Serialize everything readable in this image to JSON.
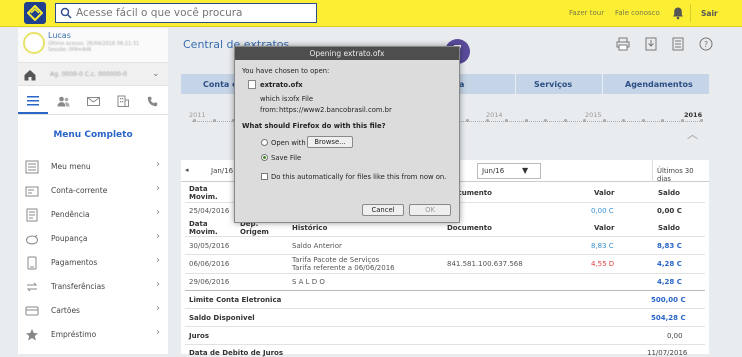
{
  "topbar": {
    "search_placeholder": "Acesse fácil o que você procura",
    "link_tour": "Fazer tour",
    "link_contact": "Fale conosco",
    "sair": "Sair"
  },
  "profile": {
    "name": "Lucas",
    "info1": "Último acesso: 26/04/2016 06:21:31",
    "info2": "Sessão: 0f4m4d6",
    "agency": "Ag. 0000-0  C.c. 000000-0"
  },
  "sidebar": {
    "menu_title": "Menu Completo",
    "items": [
      {
        "label": "Meu menu",
        "icon": "mymenu-icon"
      },
      {
        "label": "Conta-corrente",
        "icon": "account-icon"
      },
      {
        "label": "Pendência",
        "icon": "pending-icon"
      },
      {
        "label": "Poupança",
        "icon": "savings-icon"
      },
      {
        "label": "Pagamentos",
        "icon": "payments-icon"
      },
      {
        "label": "Transferências",
        "icon": "transfer-icon"
      },
      {
        "label": "Cartões",
        "icon": "cards-icon"
      },
      {
        "label": "Empréstimo",
        "icon": "loan-icon"
      }
    ]
  },
  "main": {
    "title": "Central de extratos",
    "tabs": [
      "Conta c",
      "a",
      "Serviços",
      "Agendamentos"
    ],
    "years": [
      "2011",
      "2014",
      "2015",
      "2016"
    ],
    "month_prev": "Jan/16",
    "month_select": "Jun/16",
    "last_days": "Últimos 30 dias"
  },
  "table1": {
    "headers": [
      "Data Movim.",
      "Documento",
      "Valor",
      "Saldo"
    ],
    "row": {
      "date": "25/04/2016",
      "valor": "0,00 C",
      "saldo": "0,00 C"
    }
  },
  "table2": {
    "headers": [
      "Data Movim.",
      "Dep. Origem",
      "Histórico",
      "Documento",
      "Valor",
      "Saldo"
    ],
    "rows": [
      {
        "date": "30/05/2016",
        "hist1": "Saldo Anterior",
        "hist2": "",
        "doc": "",
        "valor": "8,83 C",
        "saldo": "8,83 C"
      },
      {
        "date": "06/06/2016",
        "hist1": "Tarifa Pacote de Serviços",
        "hist2": "Tarifa referente a 06/06/2016",
        "doc": "841.581.100.637.568",
        "valor": "4,55 D",
        "saldo": "4,28 C"
      },
      {
        "date": "29/06/2016",
        "hist1": "S A L D O",
        "hist2": "",
        "doc": "",
        "valor": "",
        "saldo": "4,28 C"
      }
    ],
    "summary": [
      {
        "label": "Limite Conta Eletronica",
        "value": "500,00 C"
      },
      {
        "label": "Saldo Disponivel",
        "value": "504,28 C"
      },
      {
        "label": "Juros",
        "value": "0,00"
      },
      {
        "label": "Data de Debito de Juros",
        "value": "11/07/2016"
      }
    ]
  },
  "dialog": {
    "title": "Opening extrato.ofx",
    "intro": "You have chosen to open:",
    "filename": "extrato.ofx",
    "which_is_label": "which is:",
    "which_is_value": "ofx File",
    "from_label": "from:",
    "from_value": "https://www2.bancobrasil.com.br",
    "question": "What should Firefox do with this file?",
    "open_with": "Open with",
    "browse": "Browse...",
    "save_file": "Save File",
    "auto_label": "Do this automatically for files like this from now on.",
    "cancel": "Cancel",
    "ok": "OK"
  },
  "step_badge": "7",
  "colors": {
    "topbar": "#fcef33",
    "brand_blue": "#1f3f8f",
    "accent": "#2a66c8",
    "debit": "#e04040"
  }
}
